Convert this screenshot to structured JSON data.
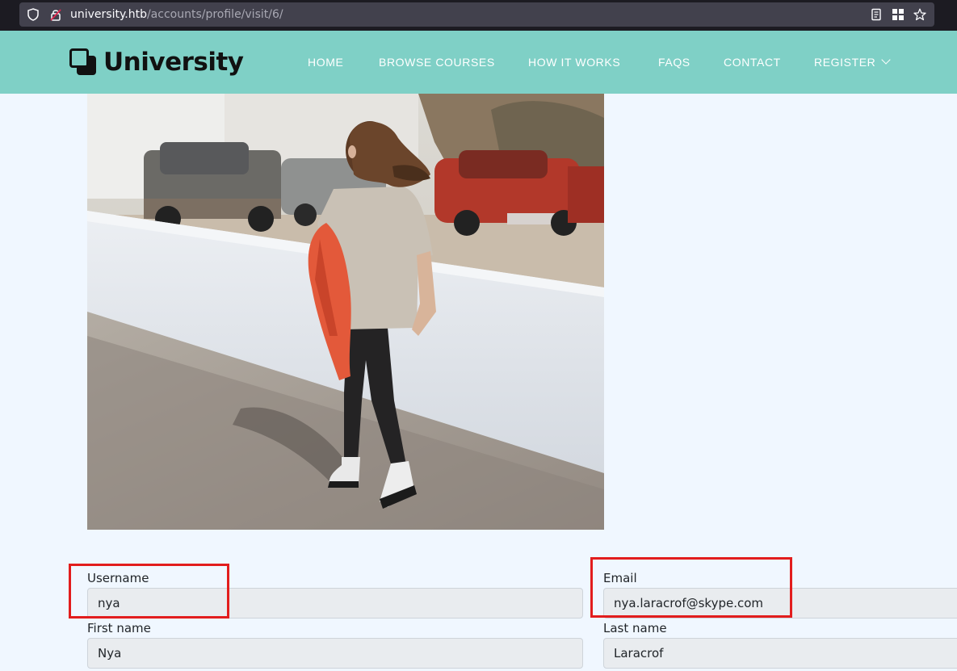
{
  "browser": {
    "url_domain": "university.htb",
    "url_path": "/accounts/profile/visit/6/"
  },
  "site": {
    "logo": "University",
    "nav": [
      "HOME",
      "BROWSE COURSES",
      "HOW IT WORKS",
      "FAQS",
      "CONTACT",
      "REGISTER"
    ]
  },
  "profile": {
    "username_label": "Username",
    "username": "nya",
    "email_label": "Email",
    "email": "nya.laracrof@skype.com",
    "first_name_label": "First name",
    "first_name": "Nya",
    "last_name_label": "Last name",
    "last_name": "Laracrof"
  },
  "colors": {
    "nav_bg": "#7fd0c6",
    "page_bg": "#f0f7ff",
    "highlight": "#e21d1d"
  }
}
